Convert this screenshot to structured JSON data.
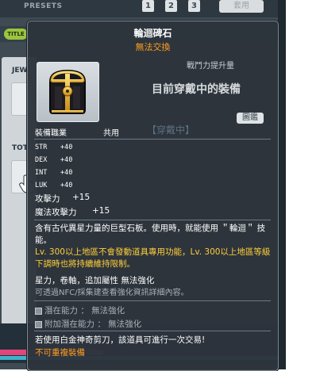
{
  "background": {
    "presets_label": "PRESETS",
    "preset_buttons": [
      "1",
      "2",
      "3"
    ],
    "apply_button": "套用",
    "left_tab_label": "TITLE",
    "side_labels": [
      "JEW",
      "TOT"
    ]
  },
  "tooltip": {
    "title": "輪迴碑石",
    "trade_status": "無法交換",
    "power_label": "戰鬥力提升量",
    "equipped_text": "目前穿戴中的裝備",
    "compare_button": "圖鑑",
    "faded_text": "【穿戴中】",
    "job_label": "裝備職業",
    "job_value": "共用",
    "stats": [
      {
        "name": "STR",
        "value": "+40"
      },
      {
        "name": "DEX",
        "value": "+40"
      },
      {
        "name": "INT",
        "value": "+40"
      },
      {
        "name": "LUK",
        "value": "+40"
      }
    ],
    "attack": {
      "label": "攻擊力",
      "value": "+15"
    },
    "magic_attack": {
      "label": "魔法攻擊力",
      "value": "+15"
    },
    "description": "含有古代異星力量的巨型石板。使用時，就能使用 ＂輪迴＂ 技能。",
    "level_note": "Lv. 300以上地區不會發動道具專用功能，Lv. 300以上地區等級下調時也將持續維持限制。",
    "attributes": "星力，卷軸，追加屬性 無法強化",
    "nfc_note": "可透過NFC/採集建查看強化資訊詳細內容。",
    "potential": "潛在能力 ： 無法強化",
    "additional_potential": "附加潛在能力 ： 無法強化",
    "scissors_note": "若使用白金神奇剪刀，該道具可進行一次交易!",
    "unique_note": "不可重複裝備"
  },
  "colors": {
    "tooltip_bg": "#2c343c",
    "orange": "#ff9e1f",
    "yellow": "#ffcf3a",
    "grey_text": "#a9b1b7"
  }
}
